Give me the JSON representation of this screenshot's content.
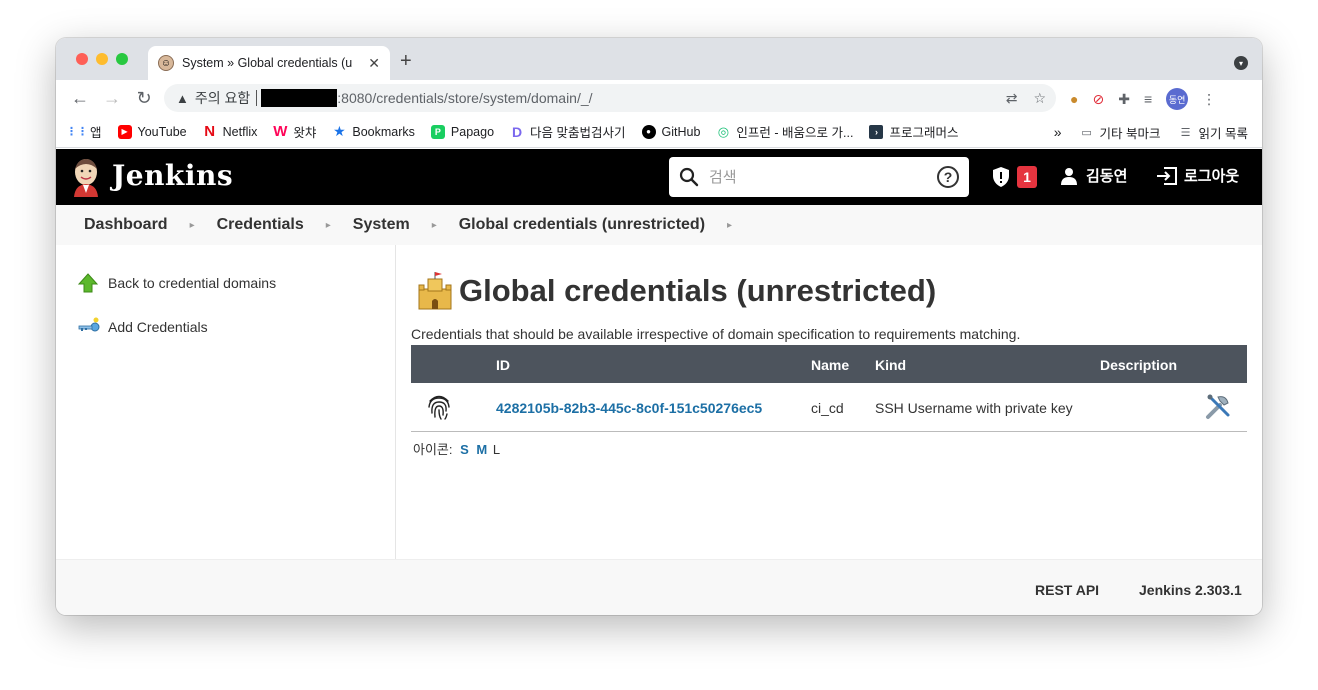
{
  "browser": {
    "tab_title": "System » Global credentials (u",
    "warning_text": "주의 요함",
    "url_text": ":8080/credentials/store/system/domain/_/",
    "profile_initials": "동연"
  },
  "bookmarks": {
    "items": [
      {
        "label": "앱",
        "icon": "apps-grid-icon",
        "color": "#4285f4"
      },
      {
        "label": "YouTube",
        "icon": "youtube-icon",
        "color": "#ff0000"
      },
      {
        "label": "Netflix",
        "icon": "netflix-icon",
        "color": "#e50914"
      },
      {
        "label": "왓챠",
        "icon": "watcha-icon",
        "color": "#ff0558"
      },
      {
        "label": "Bookmarks",
        "icon": "star-icon",
        "color": "#1a73e8"
      },
      {
        "label": "Papago",
        "icon": "papago-icon",
        "color": "#19ce60"
      },
      {
        "label": "다음 맞춤법검사기",
        "icon": "daum-icon",
        "color": "#7b68ee"
      },
      {
        "label": "GitHub",
        "icon": "github-icon",
        "color": "#000000"
      },
      {
        "label": "인프런 - 배움으로 가...",
        "icon": "inflearn-icon",
        "color": "#1dc078"
      },
      {
        "label": "프로그래머스",
        "icon": "programmers-icon",
        "color": "#263747"
      }
    ],
    "more": "»",
    "other_folder": "기타 북마크",
    "reading_list": "읽기 목록"
  },
  "header": {
    "title": "Jenkins",
    "search_placeholder": "검색",
    "alert_count": "1",
    "user_name": "김동연",
    "logout_label": "로그아웃"
  },
  "breadcrumbs": [
    "Dashboard",
    "Credentials",
    "System",
    "Global credentials (unrestricted)"
  ],
  "sidebar": {
    "back_label": "Back to credential domains",
    "add_label": "Add Credentials"
  },
  "main": {
    "title": "Global credentials (unrestricted)",
    "description": "Credentials that should be available irrespective of domain specification to requirements matching.",
    "table": {
      "headers": {
        "id": "ID",
        "name": "Name",
        "kind": "Kind",
        "description": "Description"
      },
      "rows": [
        {
          "id": "4282105b-82b3-445c-8c0f-151c50276ec5",
          "name": "ci_cd",
          "kind": "SSH Username with private key",
          "description": ""
        }
      ]
    },
    "icon_size": {
      "label": "아이콘:",
      "options": [
        "S",
        "M",
        "L"
      ],
      "selected": "L"
    }
  },
  "footer": {
    "rest_api": "REST API",
    "version": "Jenkins 2.303.1"
  }
}
